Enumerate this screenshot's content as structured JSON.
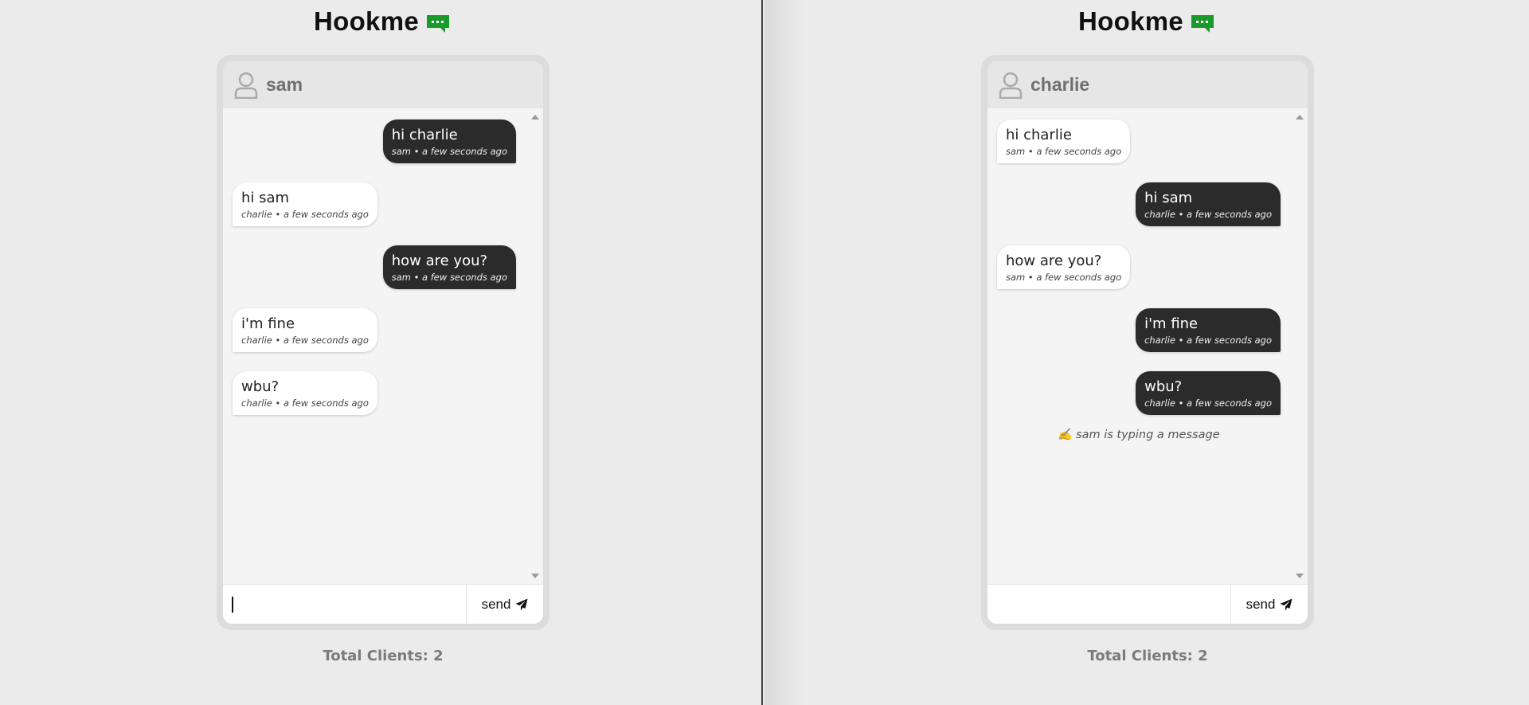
{
  "app": {
    "title": "Hookme",
    "accent": "#1a9a2a"
  },
  "left": {
    "header_name": "sam",
    "messages": [
      {
        "direction": "out",
        "text": "hi charlie",
        "meta": "sam • a few seconds ago"
      },
      {
        "direction": "in",
        "text": "hi sam",
        "meta": "charlie • a few seconds ago"
      },
      {
        "direction": "out",
        "text": "how are you?",
        "meta": "sam • a few seconds ago"
      },
      {
        "direction": "in",
        "text": "i'm fine",
        "meta": "charlie • a few seconds ago"
      },
      {
        "direction": "in",
        "text": "wbu?",
        "meta": "charlie • a few seconds ago"
      }
    ],
    "typing": "",
    "input_value": "",
    "send_label": "send",
    "total_clients": "Total Clients: 2"
  },
  "right": {
    "header_name": "charlie",
    "messages": [
      {
        "direction": "in",
        "text": "hi charlie",
        "meta": "sam • a few seconds ago"
      },
      {
        "direction": "out",
        "text": "hi sam",
        "meta": "charlie • a few seconds ago"
      },
      {
        "direction": "in",
        "text": "how are you?",
        "meta": "sam • a few seconds ago"
      },
      {
        "direction": "out",
        "text": "i'm fine",
        "meta": "charlie • a few seconds ago"
      },
      {
        "direction": "out",
        "text": "wbu?",
        "meta": "charlie • a few seconds ago"
      }
    ],
    "typing": "✍️ sam is typing a message",
    "input_value": "",
    "send_label": "send",
    "total_clients": "Total Clients: 2"
  },
  "icons": {
    "logo": "chat-bubble-icon",
    "user": "user-icon",
    "send": "paper-plane-icon"
  }
}
